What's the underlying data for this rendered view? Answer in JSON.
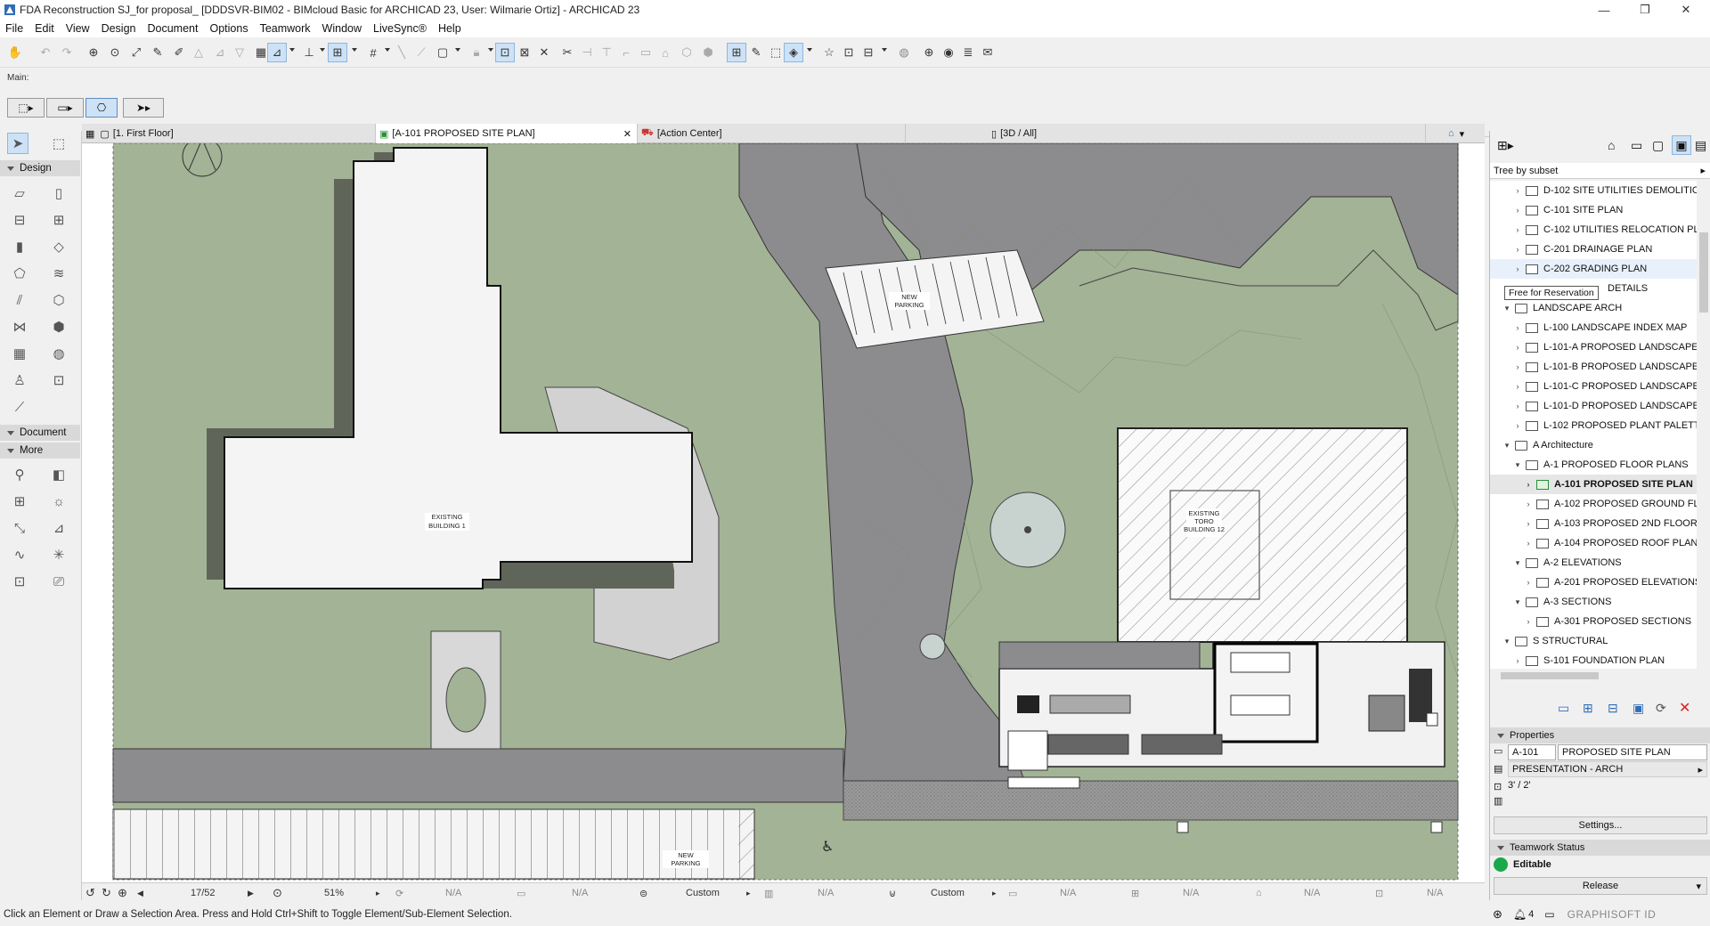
{
  "window": {
    "title": "FDA Reconstruction SJ_for proposal_ [DDDSVR-BIM02 - BIMcloud Basic for ARCHICAD 23, User: Wilmarie Ortiz] - ARCHICAD 23",
    "minimize": "—",
    "restore": "❐",
    "close": "✕"
  },
  "menu": [
    "File",
    "Edit",
    "View",
    "Design",
    "Document",
    "Options",
    "Teamwork",
    "Window",
    "LiveSync®",
    "Help"
  ],
  "info_box": {
    "label": "Main:"
  },
  "tabs": [
    {
      "label": "[1. First Floor]"
    },
    {
      "label": "[A-101 PROPOSED SITE PLAN]",
      "active": true,
      "close": "✕"
    },
    {
      "label": "[Action Center]"
    },
    {
      "label": "[3D / All]"
    }
  ],
  "toolbox": {
    "sections": [
      "Design",
      "Document",
      "More"
    ]
  },
  "drawing": {
    "labels": {
      "existing_building_1": [
        "EXISTING",
        "BUILDING 1"
      ],
      "existing_toro": [
        "EXISTING",
        "TORO",
        "BUILDING 12"
      ],
      "new_parking_top": [
        "NEW",
        "PARKING"
      ],
      "new_parking_bottom": [
        "NEW",
        "PARKING"
      ]
    },
    "colors": {
      "grass": "#a3b396",
      "road": "#8c8c8e",
      "building_fill": "#f4f4f4",
      "shadow": "#5f6559"
    }
  },
  "status_row": {
    "page": "17/52",
    "zoom": "51%",
    "na1": "N/A",
    "na2": "N/A",
    "custom1": "Custom",
    "na3": "N/A",
    "custom2": "Custom",
    "na4": "N/A",
    "na5": "N/A",
    "na6": "N/A",
    "na7": "N/A"
  },
  "status_bar": {
    "message": "Click an Element or Draw a Selection Area. Press and Hold Ctrl+Shift to Toggle Element/Sub-Element Selection."
  },
  "navigator": {
    "view_mode": "Tree by subset",
    "tooltip": "Free for Reservation",
    "items": [
      {
        "label": "D-102 SITE UTILITIES DEMOLITIO",
        "level": 2,
        "type": "layout"
      },
      {
        "label": "C-101 SITE PLAN",
        "level": 2,
        "type": "layout"
      },
      {
        "label": "C-102 UTILITIES RELOCATION PLA",
        "level": 2,
        "type": "layout"
      },
      {
        "label": "C-201 DRAINAGE PLAN",
        "level": 2,
        "type": "layout"
      },
      {
        "label": "C-202 GRADING PLAN",
        "level": 2,
        "type": "layout",
        "hover": true
      },
      {
        "label": "DETAILS",
        "level": 2,
        "type": "partial"
      },
      {
        "label": "LANDSCAPE ARCH",
        "level": 1,
        "type": "folder",
        "expanded": true
      },
      {
        "label": "L-100 LANDSCAPE INDEX MAP",
        "level": 2,
        "type": "layout"
      },
      {
        "label": "L-101-A PROPOSED LANDSCAPE S",
        "level": 2,
        "type": "layout"
      },
      {
        "label": "L-101-B PROPOSED LANDSCAPE S",
        "level": 2,
        "type": "layout"
      },
      {
        "label": "L-101-C PROPOSED LANDSCAPE S",
        "level": 2,
        "type": "layout"
      },
      {
        "label": "L-101-D PROPOSED LANDSCAPE S",
        "level": 2,
        "type": "layout"
      },
      {
        "label": "L-102 PROPOSED PLANT PALETTE",
        "level": 2,
        "type": "layout"
      },
      {
        "label": "A Architecture",
        "level": 1,
        "type": "folder",
        "expanded": true
      },
      {
        "label": "A-1 PROPOSED FLOOR PLANS",
        "level": 2,
        "type": "folder",
        "expanded": true
      },
      {
        "label": "A-101 PROPOSED SITE PLAN",
        "level": 3,
        "type": "layout",
        "selected": true
      },
      {
        "label": "A-102 PROPOSED GROUND FL",
        "level": 3,
        "type": "layout"
      },
      {
        "label": "A-103 PROPOSED 2ND FLOOR",
        "level": 3,
        "type": "layout"
      },
      {
        "label": "A-104 PROPOSED ROOF PLAN",
        "level": 3,
        "type": "layout"
      },
      {
        "label": "A-2 ELEVATIONS",
        "level": 2,
        "type": "folder",
        "expanded": true
      },
      {
        "label": "A-201 PROPOSED ELEVATIONS",
        "level": 3,
        "type": "layout"
      },
      {
        "label": "A-3 SECTIONS",
        "level": 2,
        "type": "folder",
        "expanded": true
      },
      {
        "label": "A-301 PROPOSED SECTIONS",
        "level": 3,
        "type": "layout"
      },
      {
        "label": "S STRUCTURAL",
        "level": 1,
        "type": "folder",
        "expanded": true
      },
      {
        "label": "S-101 FOUNDATION PLAN",
        "level": 2,
        "type": "layout"
      }
    ]
  },
  "properties": {
    "header": "Properties",
    "id": "A-101",
    "name": "PROPOSED SITE PLAN",
    "master": "PRESENTATION - ARCH",
    "size": "3' / 2'",
    "settings_button": "Settings..."
  },
  "teamwork": {
    "header": "Teamwork Status",
    "status": "Editable",
    "status_color": "#1aa84a",
    "release_button": "Release"
  },
  "bottom_right": {
    "count": "4",
    "brand": "GRAPHISOFT ID"
  }
}
